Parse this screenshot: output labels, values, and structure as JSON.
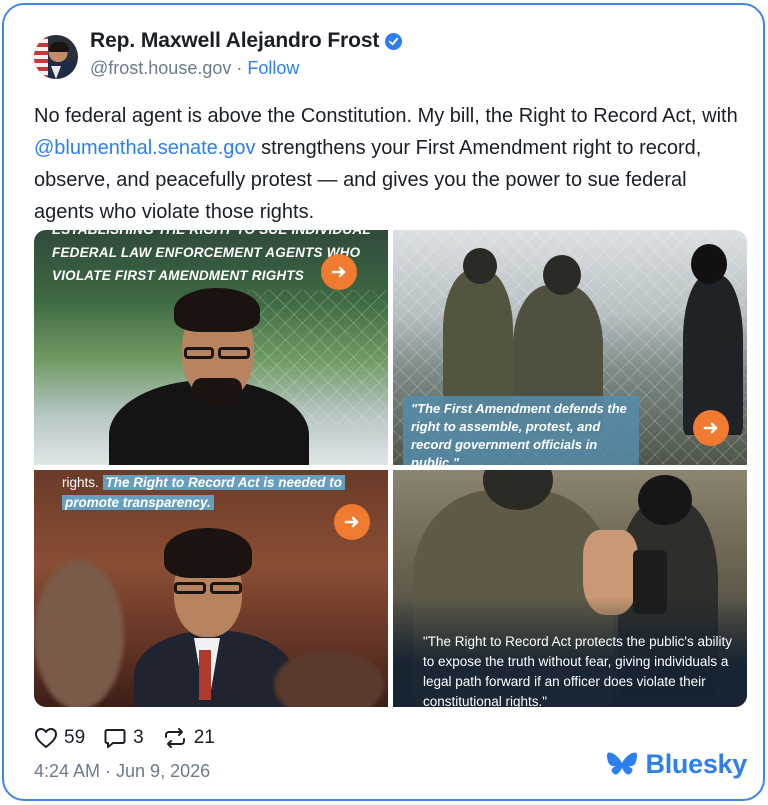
{
  "author": {
    "display_name": "Rep. Maxwell Alejandro Frost",
    "handle": "@frost.house.gov",
    "separator": " · ",
    "follow_label": "Follow"
  },
  "post": {
    "text_before": "No federal agent is above the Constitution. My bill, the Right to Record Act, with ",
    "mention": "@blumenthal.senate.gov",
    "text_after": " strengthens your First Amendment right to record, observe, and peacefully protest — and gives you the power to sue federal agents who violate those rights."
  },
  "images": [
    {
      "overlay_lines": [
        "ESTABLISHING THE RIGHT TO SUE INDIVIDUAL",
        "FEDERAL LAW ENFORCEMENT AGENTS WHO",
        "VIOLATE FIRST AMENDMENT RIGHTS"
      ]
    },
    {
      "caption": "\"The First Amendment defends the right to assemble, protest, and record government officials in public.\""
    },
    {
      "caption_plain": "rights.",
      "caption_highlight_1": "The Right to Record Act is needed to",
      "caption_highlight_2": "promote transparency."
    },
    {
      "caption": "\"The Right to Record Act protects the public's ability to expose the truth without fear, giving individuals a legal path forward if an officer does violate their constitutional rights.\""
    }
  ],
  "stats": {
    "likes": "59",
    "replies": "3",
    "reposts": "21"
  },
  "timestamp": "4:24 AM · Jun 9, 2026",
  "brand": {
    "name": "Bluesky",
    "color": "#2d7ff0"
  },
  "colors": {
    "accent": "#2d7ff0",
    "card_border": "#3f86e8",
    "arrow_button": "#f07a30"
  }
}
